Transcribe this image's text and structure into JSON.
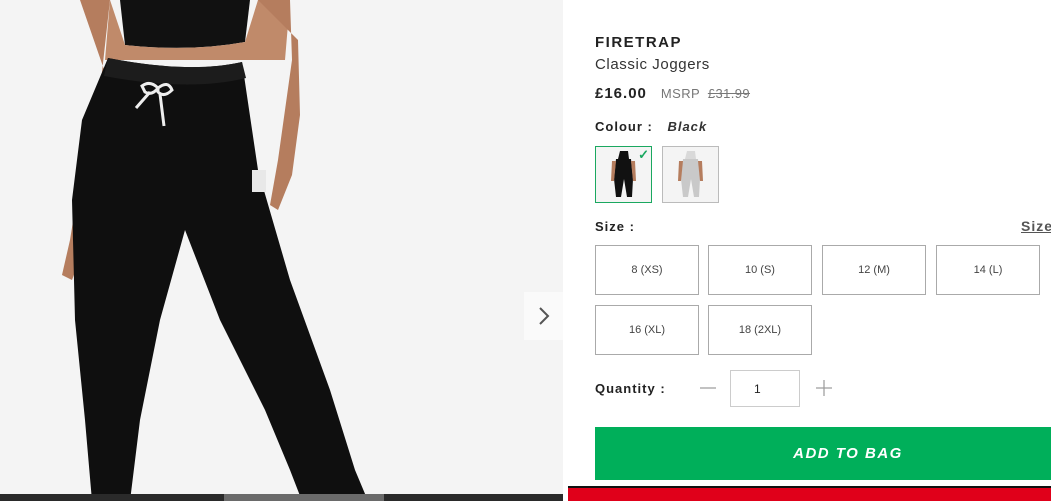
{
  "product": {
    "brand": "FIRETRAP",
    "name": "Classic Joggers",
    "price": "£16.00",
    "msrp_label": "MSRP",
    "msrp_price": "£31.99"
  },
  "colour": {
    "label": "Colour :",
    "selected": "Black",
    "swatches": [
      {
        "name": "Black",
        "selected": true,
        "color": "#111111"
      },
      {
        "name": "Grey",
        "selected": false,
        "color": "#c9c9c9"
      }
    ]
  },
  "size": {
    "label": "Size :",
    "guide_label": "Size",
    "options": [
      "8 (XS)",
      "10 (S)",
      "12 (M)",
      "14 (L)",
      "16 (XL)",
      "18 (2XL)"
    ]
  },
  "quantity": {
    "label": "Quantity :",
    "value": "1"
  },
  "actions": {
    "add_to_bag": "ADD TO BAG"
  },
  "icons": {
    "next": "chevron-right-icon",
    "minus": "minus-icon",
    "plus": "plus-icon",
    "check": "check-icon"
  },
  "colors": {
    "accent_green": "#00af5a",
    "promo_red": "#e0001a"
  }
}
